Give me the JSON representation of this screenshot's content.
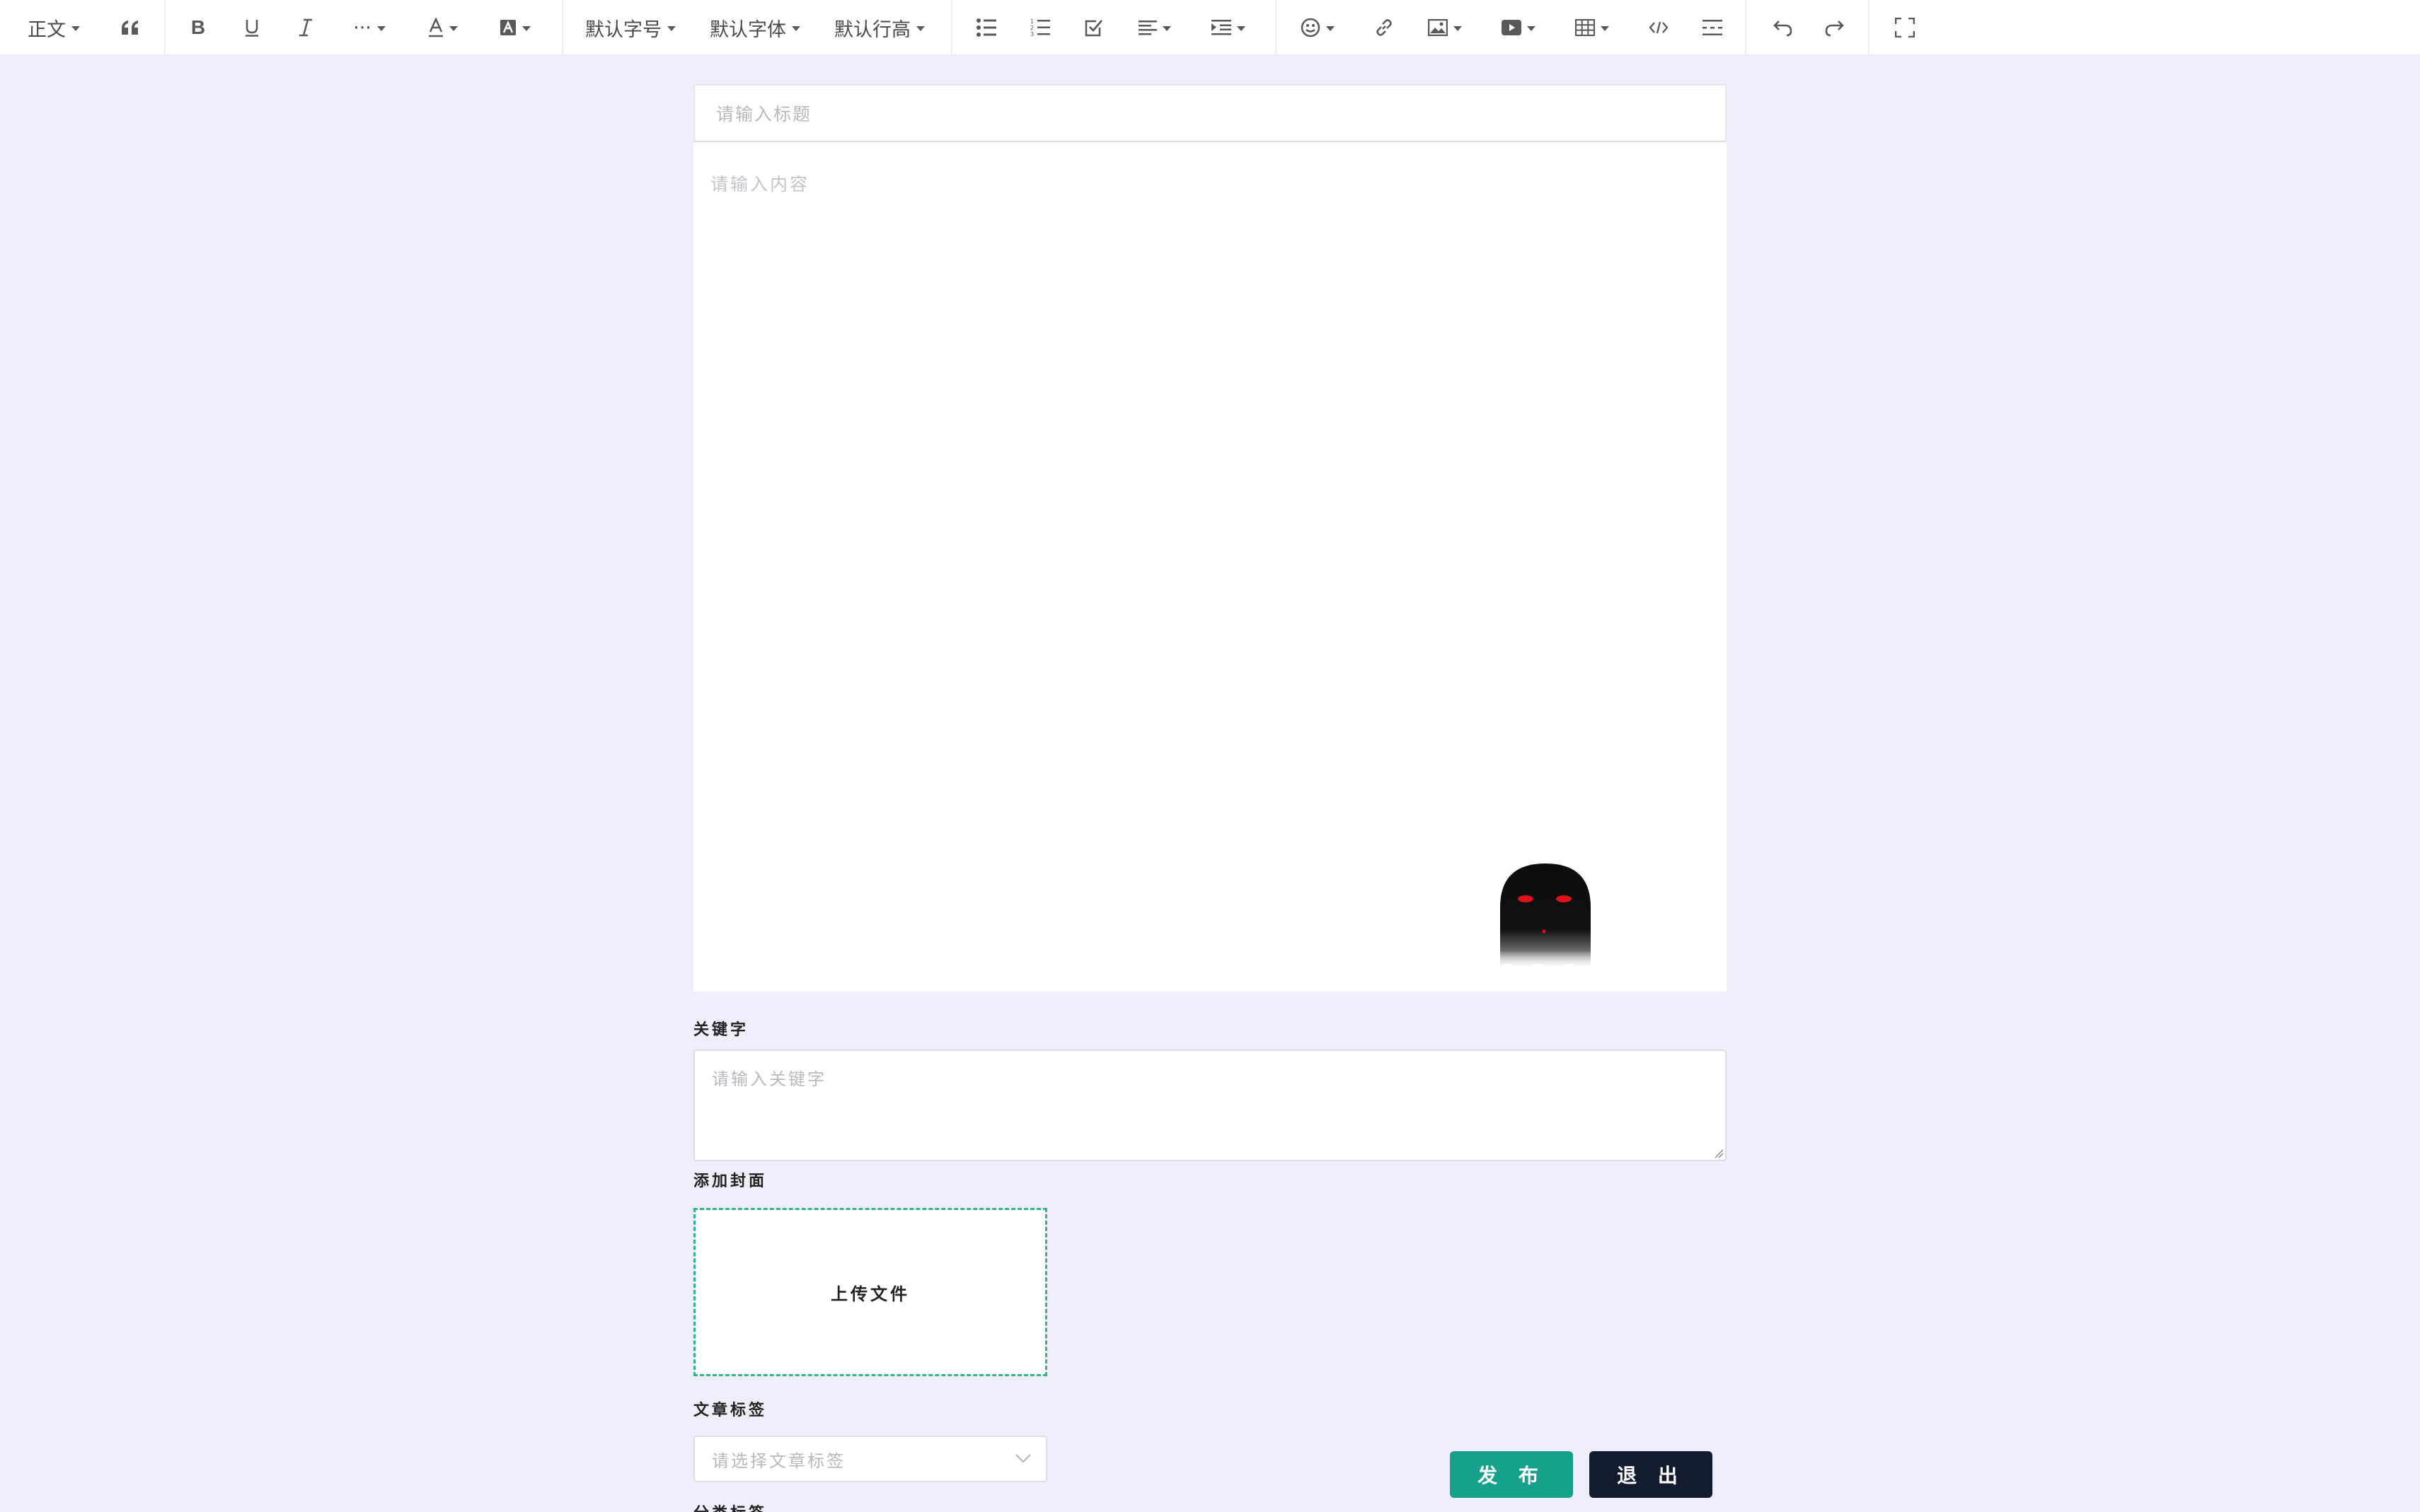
{
  "toolbar": {
    "paragraph_label": "正文",
    "font_size_label": "默认字号",
    "font_family_label": "默认字体",
    "line_height_label": "默认行高",
    "more_label": "···",
    "icons": [
      "quote-icon",
      "bold-icon",
      "underline-icon",
      "italic-icon",
      "more-icon",
      "font-color-icon",
      "bg-color-icon",
      "bullet-list-icon",
      "numbered-list-icon",
      "todo-icon",
      "align-icon",
      "indent-icon",
      "emoji-icon",
      "link-icon",
      "image-icon",
      "video-icon",
      "table-icon",
      "code-icon",
      "divider-icon",
      "undo-icon",
      "redo-icon",
      "fullscreen-icon"
    ]
  },
  "editor": {
    "title_placeholder": "请输入标题",
    "content_placeholder": "请输入内容"
  },
  "form": {
    "keywords_label": "关键字",
    "keywords_placeholder": "请输入关键字",
    "cover_label": "添加封面",
    "upload_label": "上传文件",
    "tags_label": "文章标签",
    "tags_placeholder": "请选择文章标签",
    "category_label": "分类标签"
  },
  "actions": {
    "publish_label": "发 布",
    "exit_label": "退 出"
  },
  "colors": {
    "background": "#efeefa",
    "accent": "#15a18c",
    "dark": "#131b2e",
    "upload_border": "#2fb58b"
  }
}
